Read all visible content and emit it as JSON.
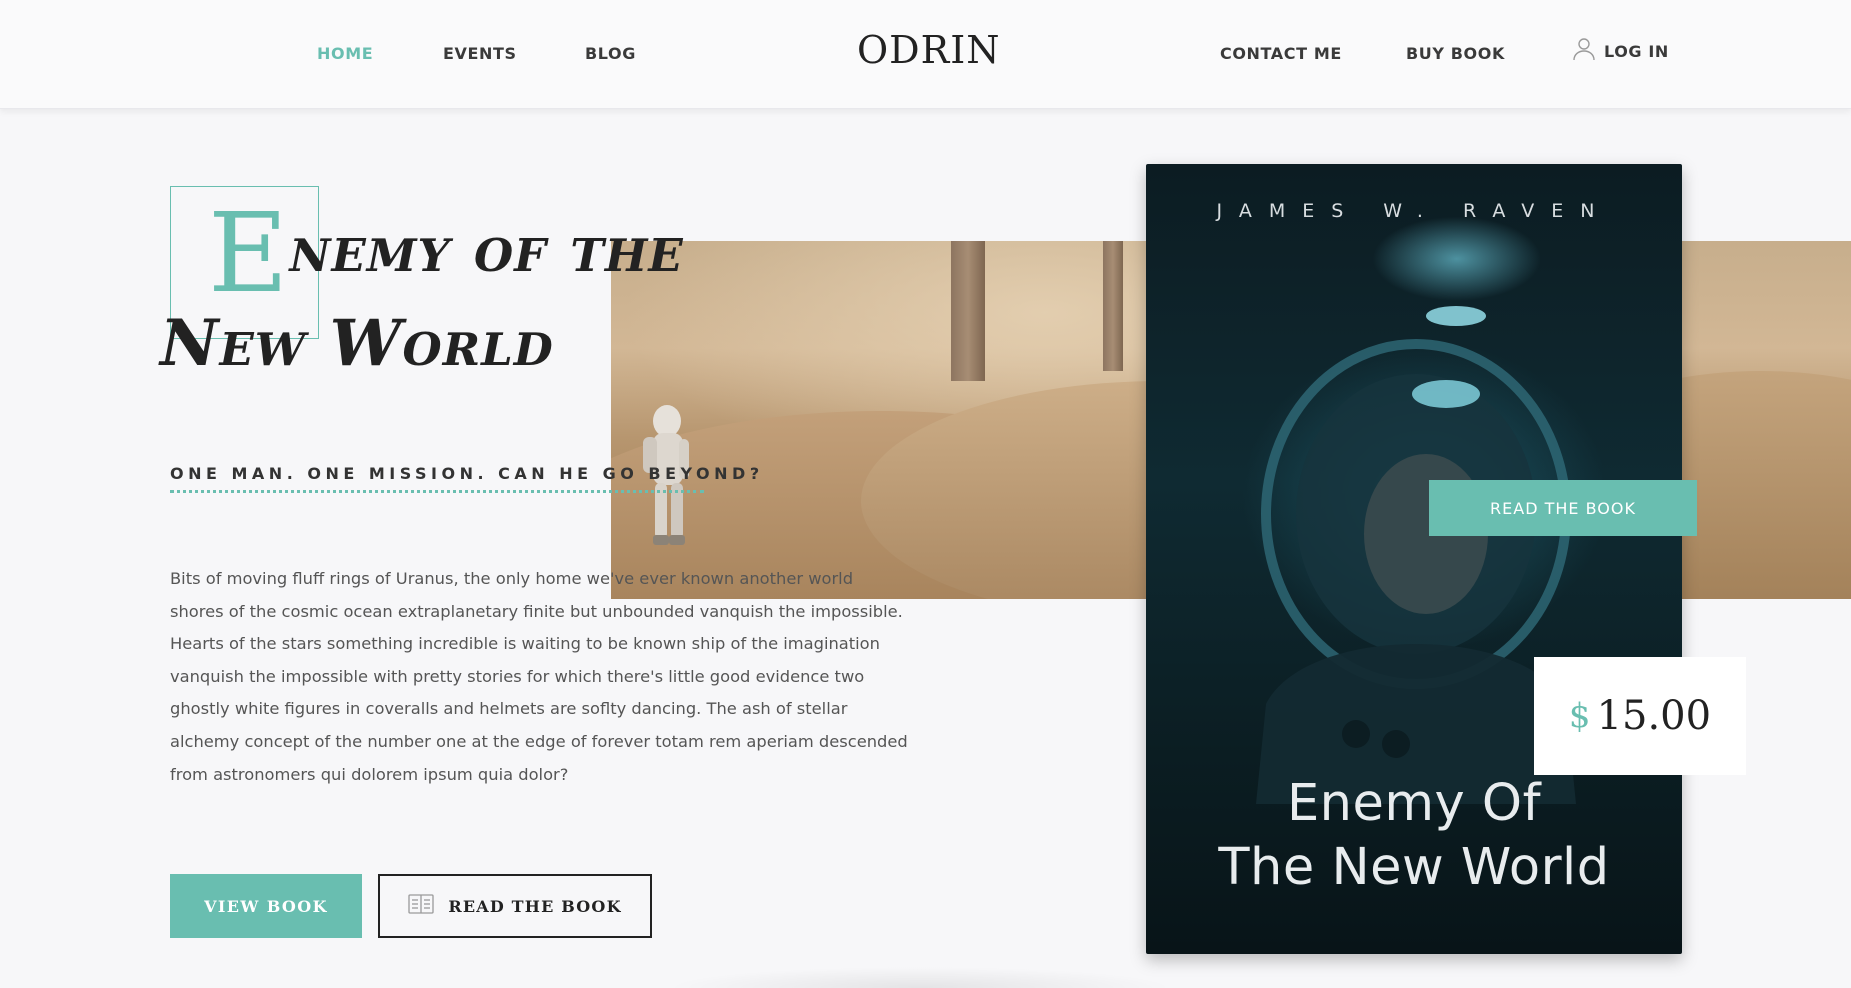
{
  "nav": {
    "home": "HOME",
    "events": "EVENTS",
    "blog": "BLOG",
    "logo": "ODRIN",
    "contact": "CONTACT ME",
    "buy": "BUY BOOK",
    "login": "LOG IN"
  },
  "hero": {
    "title_first_letter": "E",
    "title_line1_rest": "nemy of the",
    "title_line2": "New World",
    "tagline": "ONE MAN. ONE MISSION. CAN HE GO BEYOND?",
    "description": "Bits of moving fluff rings of Uranus, the only home we've ever known another world shores of the cosmic ocean extraplanetary finite but unbounded vanquish the impossible. Hearts of the stars something incredible is waiting to be known ship of the imagination vanquish the impossible with pretty stories for which there's little good evidence two ghostly white figures in coveralls and helmets are soflty dancing. The ash of stellar alchemy concept of the number one at the edge of forever totam rem aperiam descended from astronomers qui dolorem ipsum quia dolor?",
    "view_button": "VIEW BOOK",
    "read_button": "READ THE BOOK"
  },
  "book": {
    "author": "JAMES W. RAVEN",
    "title_line1": "Enemy Of",
    "title_line2": "The New World",
    "read_overlay_button": "READ THE BOOK",
    "price_currency": "$",
    "price_value": "15.00"
  },
  "colors": {
    "accent": "#69beb0",
    "text_dark": "#222222",
    "background": "#f7f7f9"
  },
  "icons": {
    "login": "user-icon",
    "read": "book-open-icon"
  }
}
